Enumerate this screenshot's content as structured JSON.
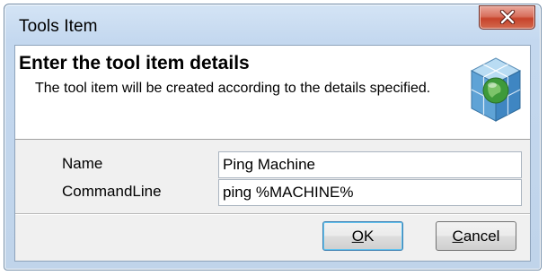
{
  "window": {
    "title": "Tools Item"
  },
  "header": {
    "title": "Enter the tool item details",
    "description": "The tool item will be created according to the details specified.",
    "icon": "globe-cube-icon"
  },
  "form": {
    "fields": [
      {
        "label": "Name",
        "value": "Ping Machine"
      },
      {
        "label": "CommandLine",
        "value": "ping %MACHINE%"
      }
    ]
  },
  "buttons": {
    "ok": {
      "accel": "O",
      "rest": "K"
    },
    "cancel": {
      "accel": "C",
      "rest": "ancel"
    }
  },
  "colors": {
    "titlebar": "#c4d8ef",
    "close_button": "#c7432b",
    "header_panel": "#ffffff",
    "dialog_body": "#f0f0f0",
    "default_button_border": "#3c7fb1"
  }
}
